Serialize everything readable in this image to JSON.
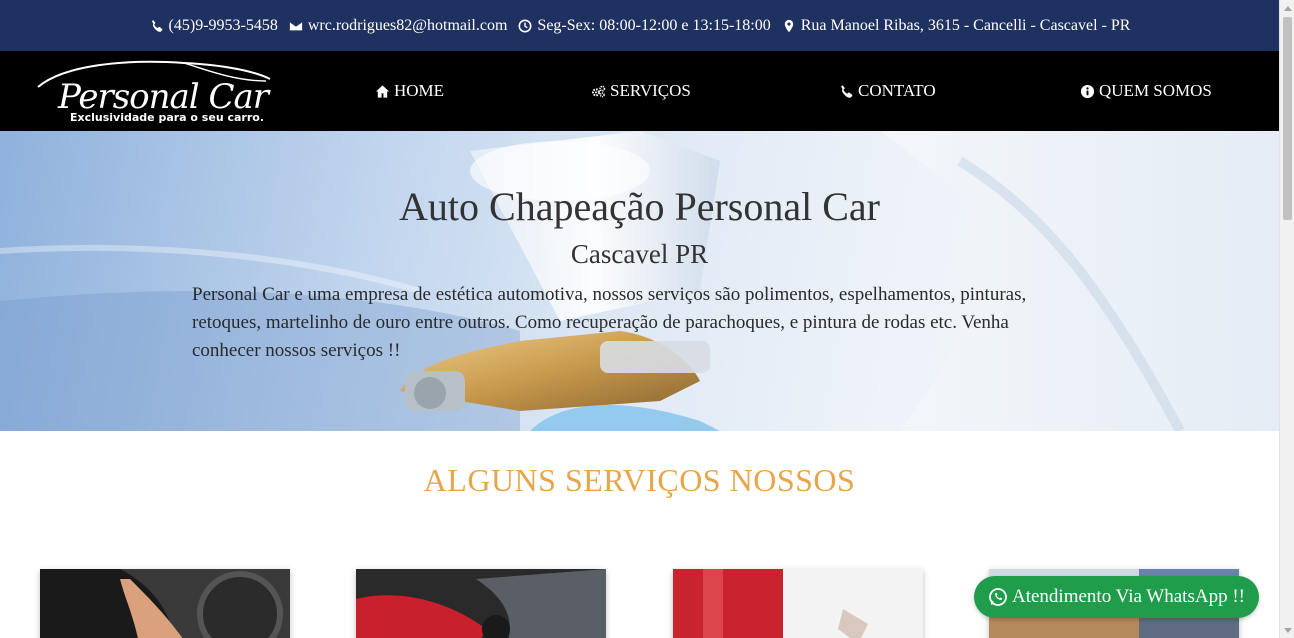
{
  "topbar": {
    "phone": "(45)9-9953-5458",
    "email": "wrc.rodrigues82@hotmail.com",
    "hours": "Seg-Sex: 08:00-12:00 e 13:15-18:00",
    "address": "Rua Manoel Ribas, 3615 - Cancelli - Cascavel - PR",
    "icons": [
      "phone-icon",
      "envelope-icon",
      "clock-icon",
      "map-marker-icon"
    ]
  },
  "logo": {
    "name": "Personal Car",
    "tagline": "Exclusividade para o seu carro."
  },
  "nav": {
    "items": [
      {
        "label": "HOME",
        "icon": "home-icon"
      },
      {
        "label": "SERVIÇOS",
        "icon": "cogs-icon"
      },
      {
        "label": "CONTATO",
        "icon": "phone-icon"
      },
      {
        "label": "QUEM SOMOS",
        "icon": "info-circle-icon"
      }
    ]
  },
  "hero": {
    "title": "Auto Chapeação Personal Car",
    "subtitle": "Cascavel PR",
    "text": "Personal Car e uma empresa de estética automotiva, nossos serviços são polimentos, espelhamentos, pinturas, retoques, martelinho de ouro entre outros. Como recuperação de parachoques, e pintura de rodas etc. Venha conhecer nossos serviços !!"
  },
  "services": {
    "title": "ALGUNS SERVIÇOS NOSSOS"
  },
  "whatsapp": {
    "label": "Atendimento Via WhatsApp !!",
    "color": "#1f9d4a"
  },
  "colors": {
    "topbar": "#1f3160",
    "navbar": "#000000",
    "accent": "#e8a64c"
  }
}
